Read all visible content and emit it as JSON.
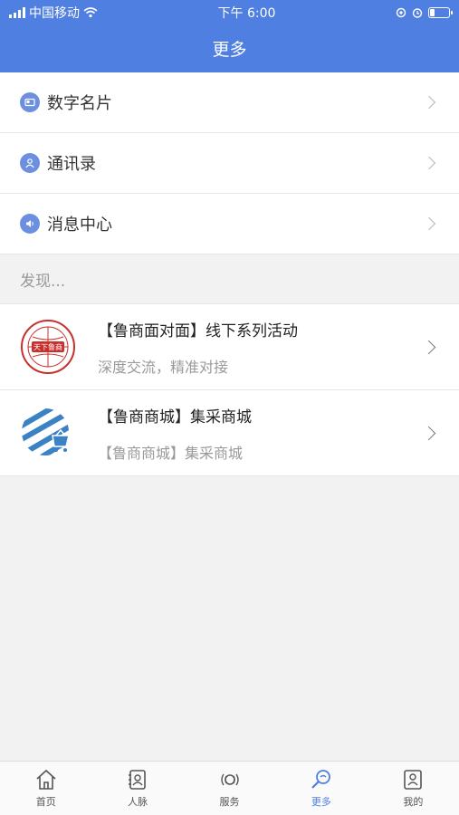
{
  "status": {
    "carrier": "中国移动",
    "time": "下午 6:00"
  },
  "header": {
    "title": "更多"
  },
  "menu": [
    {
      "label": "数字名片",
      "icon": "business-card-icon"
    },
    {
      "label": "通讯录",
      "icon": "contacts-icon"
    },
    {
      "label": "消息中心",
      "icon": "speaker-icon"
    }
  ],
  "discover_label": "发现...",
  "cards": [
    {
      "title": "【鲁商面对面】线下系列活动",
      "subtitle": "深度交流，精准对接",
      "logo_text": "天下鲁商"
    },
    {
      "title": "【鲁商商城】集采商城",
      "subtitle": "【鲁商商城】集采商城"
    }
  ],
  "tabs": [
    {
      "label": "首页",
      "icon": "home-icon"
    },
    {
      "label": "人脉",
      "icon": "connections-icon"
    },
    {
      "label": "服务",
      "icon": "service-icon"
    },
    {
      "label": "更多",
      "icon": "more-search-icon",
      "active": true
    },
    {
      "label": "我的",
      "icon": "profile-icon"
    }
  ],
  "colors": {
    "primary": "#4f7fe0",
    "logo_red": "#c8302e",
    "logo_blue": "#3a82c4"
  }
}
